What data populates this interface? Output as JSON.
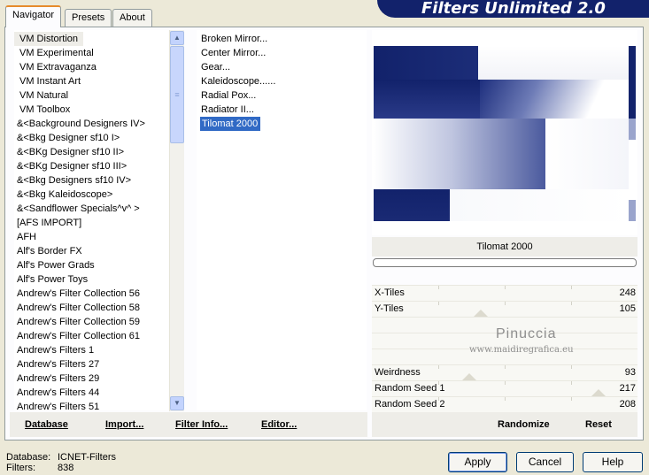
{
  "banner_title": "Filters Unlimited 2.0",
  "tabs": [
    {
      "label": "Navigator",
      "active": true
    },
    {
      "label": "Presets",
      "active": false
    },
    {
      "label": "About",
      "active": false
    }
  ],
  "categories": [
    "VM Distortion",
    "VM Experimental",
    "VM Extravaganza",
    "VM Instant Art",
    "VM Natural",
    "VM Toolbox",
    "&<Background Designers IV>",
    "&<Bkg Designer sf10 I>",
    "&<BKg Designer sf10 II>",
    "&<BKg Designer sf10 III>",
    "&<Bkg Designers sf10 IV>",
    "&<Bkg Kaleidoscope>",
    "&<Sandflower Specials^v^ >",
    "[AFS IMPORT]",
    "AFH",
    "Alf's Border FX",
    "Alf's Power Grads",
    "Alf's Power Toys",
    "Andrew's Filter Collection 56",
    "Andrew's Filter Collection 58",
    "Andrew's Filter Collection 59",
    "Andrew's Filter Collection 61",
    "Andrew's Filters 1",
    "Andrew's Filters 27",
    "Andrew's Filters 29",
    "Andrew's Filters 44",
    "Andrew's Filters 51"
  ],
  "selected_category": "VM Distortion",
  "filters": [
    "Broken Mirror...",
    "Center Mirror...",
    "Gear...",
    "Kaleidoscope......",
    "Radial Pox...",
    "Radiator II...",
    "Tilomat 2000"
  ],
  "selected_filter": "Tilomat 2000",
  "current_filter_name": "Tilomat 2000",
  "sliders": {
    "x_tiles": {
      "label": "X-Tiles",
      "value": "248"
    },
    "y_tiles": {
      "label": "Y-Tiles",
      "value": "105"
    },
    "weirdness": {
      "label": "Weirdness",
      "value": "93"
    },
    "seed1": {
      "label": "Random Seed 1",
      "value": "217"
    },
    "seed2": {
      "label": "Random Seed 2",
      "value": "208"
    }
  },
  "watermark": {
    "line1": "Pinuccia",
    "line2": "www.maidiregrafica.eu"
  },
  "left_buttons": {
    "database": "Database",
    "import": "Import...",
    "filter_info": "Filter Info...",
    "editor": "Editor..."
  },
  "right_buttons": {
    "randomize": "Randomize",
    "reset": "Reset"
  },
  "footer": {
    "database_label": "Database:",
    "database_value": "ICNET-Filters",
    "filters_label": "Filters:",
    "filters_value": "838"
  },
  "dialog_buttons": {
    "apply": "Apply",
    "cancel": "Cancel",
    "help": "Help"
  },
  "colors": {
    "navy": "#12226b",
    "selection": "#316ac5",
    "tab_accent": "#e68b2c"
  }
}
